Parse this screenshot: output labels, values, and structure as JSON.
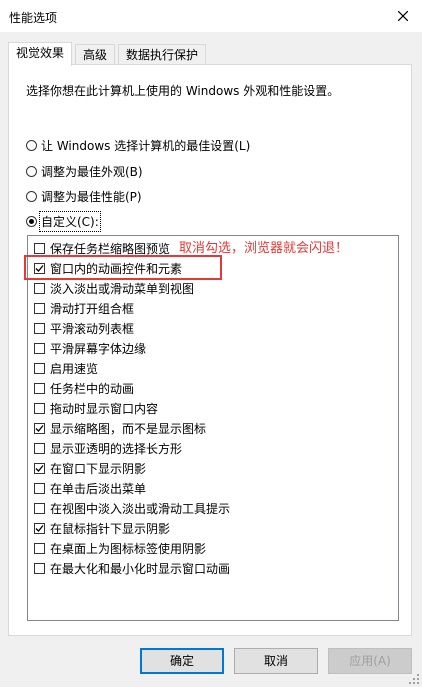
{
  "window": {
    "title": "性能选项"
  },
  "tabs": [
    {
      "label": "视觉效果"
    },
    {
      "label": "高级"
    },
    {
      "label": "数据执行保护"
    }
  ],
  "description": "选择你想在此计算机上使用的 Windows 外观和性能设置。",
  "radios": [
    {
      "label": "让 Windows 选择计算机的最佳设置(L)",
      "selected": false
    },
    {
      "label": "调整为最佳外观(B)",
      "selected": false
    },
    {
      "label": "调整为最佳性能(P)",
      "selected": false
    },
    {
      "label": "自定义(C):",
      "selected": true
    }
  ],
  "options": [
    {
      "label": "保存任务栏缩略图预览",
      "checked": false
    },
    {
      "label": "窗口内的动画控件和元素",
      "checked": true
    },
    {
      "label": "淡入淡出或滑动菜单到视图",
      "checked": false
    },
    {
      "label": "滑动打开组合框",
      "checked": false
    },
    {
      "label": "平滑滚动列表框",
      "checked": false
    },
    {
      "label": "平滑屏幕字体边缘",
      "checked": false
    },
    {
      "label": "启用速览",
      "checked": false
    },
    {
      "label": "任务栏中的动画",
      "checked": false
    },
    {
      "label": "拖动时显示窗口内容",
      "checked": false
    },
    {
      "label": "显示缩略图，而不是显示图标",
      "checked": true
    },
    {
      "label": "显示亚透明的选择长方形",
      "checked": false
    },
    {
      "label": "在窗口下显示阴影",
      "checked": true
    },
    {
      "label": "在单击后淡出菜单",
      "checked": false
    },
    {
      "label": "在视图中淡入淡出或滑动工具提示",
      "checked": false
    },
    {
      "label": "在鼠标指针下显示阴影",
      "checked": true
    },
    {
      "label": "在桌面上为图标标签使用阴影",
      "checked": false
    },
    {
      "label": "在最大化和最小化时显示窗口动画",
      "checked": false
    }
  ],
  "annotation": {
    "text": "取消勾选，浏览器就会闪退！",
    "color": "#e53935"
  },
  "buttons": {
    "ok": "确定",
    "cancel": "取消",
    "apply": "应用(A)"
  },
  "icons": {
    "close": "close-icon",
    "check": "check-icon",
    "resize": "resize-grip-icon"
  }
}
